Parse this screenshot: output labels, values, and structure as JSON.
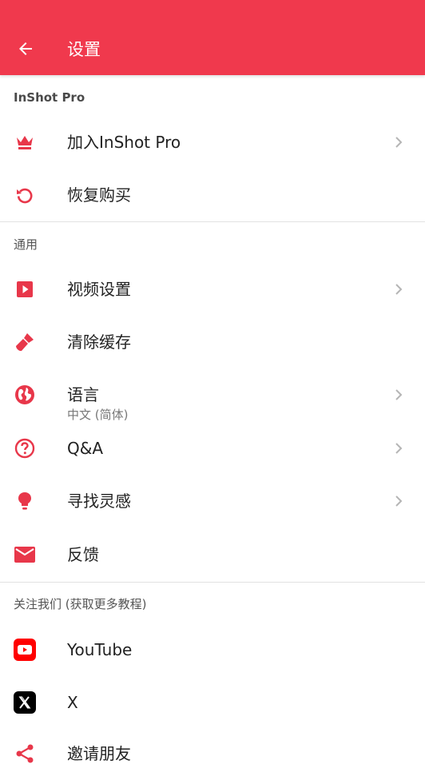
{
  "header": {
    "title": "设置"
  },
  "sections": [
    {
      "header": "InShot Pro",
      "items": [
        {
          "label": "加入InShot Pro",
          "icon": "crown-icon"
        },
        {
          "label": "恢复购买",
          "icon": "restore-icon"
        }
      ]
    },
    {
      "header": "通用",
      "items": [
        {
          "label": "视频设置",
          "icon": "video-settings-icon"
        },
        {
          "label": "清除缓存",
          "icon": "brush-icon"
        },
        {
          "label": "语言",
          "sublabel": "中文 (简体)",
          "icon": "globe-icon"
        },
        {
          "label": "Q&A",
          "icon": "help-icon"
        },
        {
          "label": "寻找灵感",
          "icon": "lightbulb-icon"
        },
        {
          "label": "反馈",
          "icon": "mail-icon"
        }
      ]
    },
    {
      "header": "关注我们 (获取更多教程)",
      "items": [
        {
          "label": "YouTube",
          "icon": "youtube-icon"
        },
        {
          "label": "X",
          "icon": "x-icon"
        },
        {
          "label": "邀请朋友",
          "icon": "share-icon"
        }
      ]
    }
  ],
  "colors": {
    "accent": "#f0394d",
    "icon": "#e8374a",
    "youtube": "#ff0000",
    "x": "#000000",
    "divider": "#e2e2e2"
  }
}
